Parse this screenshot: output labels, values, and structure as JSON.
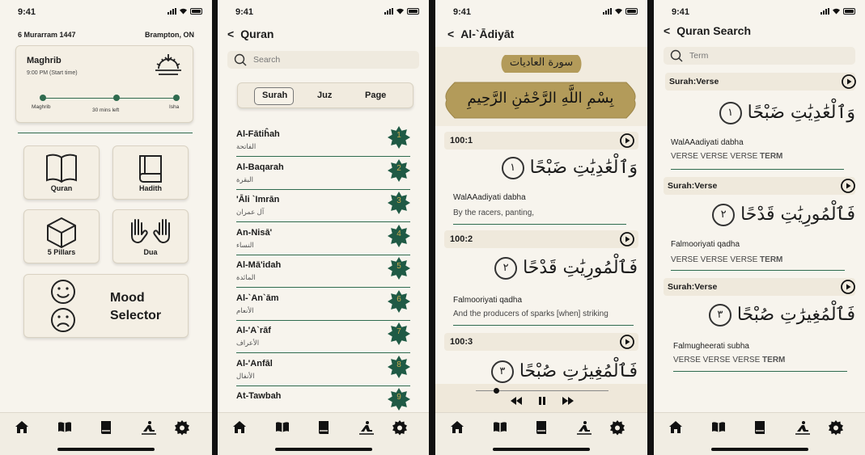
{
  "status": {
    "time": "9:41"
  },
  "home": {
    "hijri_date": "6 Murarram 1447",
    "location": "Brampton, ON",
    "prayer": {
      "name": "Maghrib",
      "time": "9:00 PM (Start time)",
      "from": "Maghrib",
      "remaining": "30 mins left",
      "to": "Isha",
      "progress": 0.55
    },
    "tiles": {
      "quran": "Quran",
      "hadith": "Hadith",
      "pillars": "5 Pillars",
      "dua": "Dua",
      "mood_line1": "Mood",
      "mood_line2": "Selector"
    }
  },
  "quran": {
    "title": "Quran",
    "search_placeholder": "Search",
    "tabs": [
      "Surah",
      "Juz",
      "Page"
    ],
    "selected_tab": "Surah",
    "surahs": [
      {
        "name": "Al-Fātiĥah",
        "arabic": "الفاتحة",
        "num": "1"
      },
      {
        "name": "Al-Baqarah",
        "arabic": "البقرة",
        "num": "2"
      },
      {
        "name": "'Āli `Imrān",
        "arabic": "آل عمران",
        "num": "3"
      },
      {
        "name": "An-Nisā'",
        "arabic": "النساء",
        "num": "4"
      },
      {
        "name": "Al-Mā'idah",
        "arabic": "المائدة",
        "num": "5"
      },
      {
        "name": "Al-`An`ām",
        "arabic": "الأنعام",
        "num": "6"
      },
      {
        "name": "Al-'A`rāf",
        "arabic": "الأعراف",
        "num": "7"
      },
      {
        "name": "Al-'Anfāl",
        "arabic": "الأنفال",
        "num": "8"
      },
      {
        "name": "At-Tawbah",
        "arabic": "",
        "num": "9"
      }
    ]
  },
  "surah_view": {
    "title": "Al-`Ādiyāt",
    "surah_banner": "سورة العاديات",
    "basmala": "بِسْمِ اللَّهِ الرَّحْمَٰنِ الرَّحِيمِ",
    "verses": [
      {
        "ref": "100:1",
        "arabic": "وَٱلْعَٰدِيَٰتِ ضَبْحًا",
        "num": "١",
        "translit": "WalAAadiyati dabha",
        "translation": "By the racers, panting,"
      },
      {
        "ref": "100:2",
        "arabic": "فَٱلْمُورِيَٰتِ قَدْحًا",
        "num": "٢",
        "translit": "Falmooriyati qadha",
        "translation": "And the producers of sparks [when] striking"
      },
      {
        "ref": "100:3",
        "arabic": "فَٱلْمُغِيرَٰتِ صُبْحًا",
        "num": "٣",
        "translit": "",
        "translation": ""
      }
    ],
    "playback_progress": 0.15
  },
  "search_view": {
    "title": "Quran Search",
    "placeholder": "Term",
    "results": [
      {
        "ref": "Surah:Verse",
        "arabic": "وَٱلْعَٰدِيَٰتِ ضَبْحًا",
        "num": "١",
        "translit": "WalAAadiyati dabha",
        "context": "VERSE VERSE VERSE",
        "term": "TERM"
      },
      {
        "ref": "Surah:Verse",
        "arabic": "فَٱلْمُورِيَٰتِ قَدْحًا",
        "num": "٢",
        "translit": "Falmooriyati qadha",
        "context": "VERSE VERSE VERSE",
        "term": "TERM"
      },
      {
        "ref": "Surah:Verse",
        "arabic": "فَٱلْمُغِيرَٰتِ صُبْحًا",
        "num": "٣",
        "translit": "Falmugheerati subha",
        "context": "VERSE VERSE VERSE",
        "term": "TERM"
      }
    ]
  },
  "nav": [
    "home-icon",
    "quran-icon",
    "hadith-icon",
    "prayer-icon",
    "settings-icon"
  ],
  "colors": {
    "accent": "#2f6b4f",
    "gold": "#b39b5a",
    "background": "#f7f4ed"
  }
}
